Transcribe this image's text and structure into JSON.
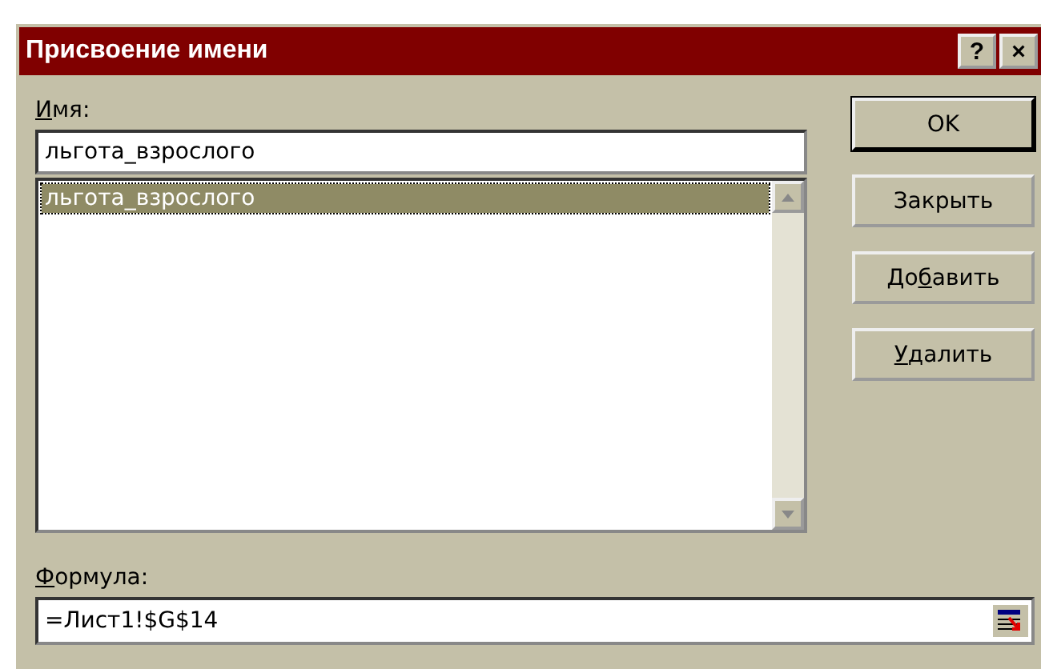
{
  "window": {
    "title": "Присвоение имени",
    "title_buttons": [
      "?",
      "×"
    ]
  },
  "name_label": {
    "key": "И",
    "rest": "мя:"
  },
  "name_field": {
    "value": "льгота_взрослого"
  },
  "names_list": [
    {
      "label": "льгота_взрослого",
      "selected": true
    }
  ],
  "buttons": [
    {
      "after": "OK",
      "default": true
    },
    {
      "after": "Закрыть",
      "default": false
    },
    {
      "before": "До",
      "key": "б",
      "after": "авить",
      "default": false
    },
    {
      "key": "У",
      "after": "далить",
      "default": false
    }
  ],
  "formula_label": {
    "key": "Ф",
    "rest": "ормула:"
  },
  "formula_field": {
    "value": "=Лист1!$G$14"
  }
}
